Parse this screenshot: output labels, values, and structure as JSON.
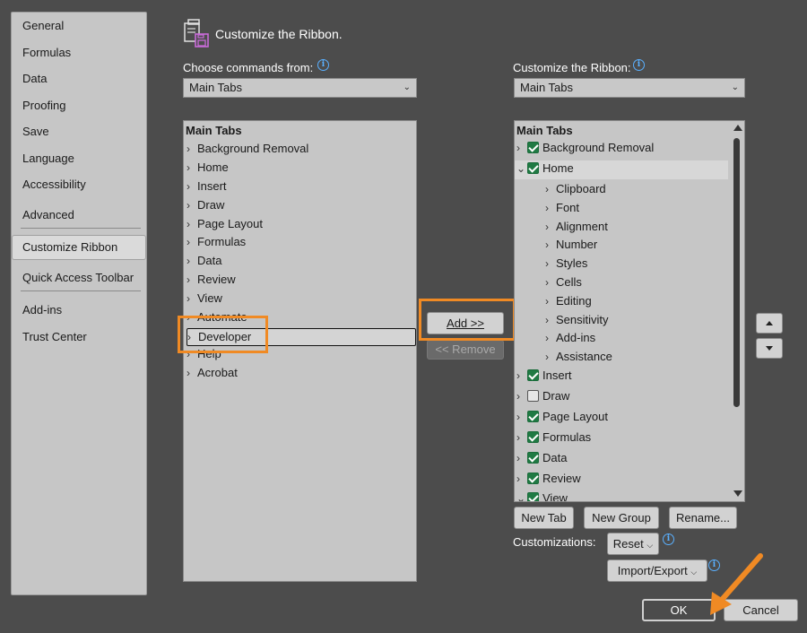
{
  "nav": {
    "items": [
      "General",
      "Formulas",
      "Data",
      "Proofing",
      "Save",
      "Language",
      "Accessibility",
      "Advanced",
      "Customize Ribbon",
      "Quick Access Toolbar",
      "Add-ins",
      "Trust Center"
    ],
    "selected": "Customize Ribbon"
  },
  "header": {
    "title": "Customize the Ribbon."
  },
  "left": {
    "label": "Choose commands from:",
    "dropdown_value": "Main Tabs",
    "list_header": "Main Tabs",
    "items": [
      "Background Removal",
      "Home",
      "Insert",
      "Draw",
      "Page Layout",
      "Formulas",
      "Data",
      "Review",
      "View",
      "Automate",
      "Developer",
      "Help",
      "Acrobat"
    ],
    "selected": "Developer"
  },
  "middle": {
    "add_label": "Add >>",
    "remove_label": "<< Remove"
  },
  "right": {
    "label": "Customize the Ribbon:",
    "dropdown_value": "Main Tabs",
    "list_header": "Main Tabs",
    "items": [
      {
        "label": "Background Removal",
        "checked": true,
        "expanded": false,
        "level": 0
      },
      {
        "label": "Home",
        "checked": true,
        "expanded": true,
        "level": 0
      },
      {
        "label": "Clipboard",
        "level": 1
      },
      {
        "label": "Font",
        "level": 1
      },
      {
        "label": "Alignment",
        "level": 1
      },
      {
        "label": "Number",
        "level": 1
      },
      {
        "label": "Styles",
        "level": 1
      },
      {
        "label": "Cells",
        "level": 1
      },
      {
        "label": "Editing",
        "level": 1
      },
      {
        "label": "Sensitivity",
        "level": 1
      },
      {
        "label": "Add-ins",
        "level": 1
      },
      {
        "label": "Assistance",
        "level": 1
      },
      {
        "label": "Insert",
        "checked": true,
        "expanded": false,
        "level": 0
      },
      {
        "label": "Draw",
        "checked": false,
        "expanded": false,
        "level": 0
      },
      {
        "label": "Page Layout",
        "checked": true,
        "expanded": false,
        "level": 0
      },
      {
        "label": "Formulas",
        "checked": true,
        "expanded": false,
        "level": 0
      },
      {
        "label": "Data",
        "checked": true,
        "expanded": false,
        "level": 0
      },
      {
        "label": "Review",
        "checked": true,
        "expanded": false,
        "level": 0
      },
      {
        "label": "View",
        "checked": true,
        "expanded": false,
        "level": 0
      }
    ],
    "new_tab": "New Tab",
    "new_group": "New Group",
    "rename": "Rename...",
    "customizations_label": "Customizations:",
    "reset": "Reset",
    "import_export": "Import/Export"
  },
  "footer": {
    "ok": "OK",
    "cancel": "Cancel"
  },
  "colors": {
    "highlight": "#f08a24",
    "check": "#1f7a43",
    "info": "#5ab0ff"
  },
  "icons": [
    "customize-ribbon-icon",
    "info-icon",
    "chevron-down-icon",
    "chevron-right-icon",
    "move-up-icon",
    "move-down-icon",
    "pointer-arrow-icon"
  ]
}
